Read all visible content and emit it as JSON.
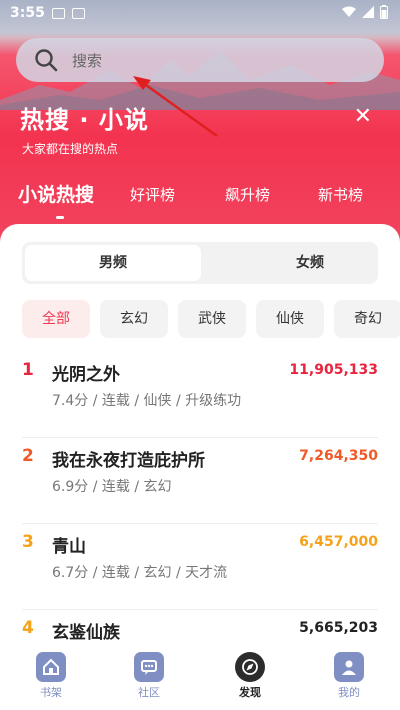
{
  "status_bar": {
    "time": "3:55"
  },
  "search": {
    "placeholder": "搜索"
  },
  "hero": {
    "title": "热搜 · 小说",
    "subtitle": "大家都在搜的热点"
  },
  "tabs": [
    {
      "label": "小说热搜"
    },
    {
      "label": "好评榜"
    },
    {
      "label": "飙升榜"
    },
    {
      "label": "新书榜"
    }
  ],
  "gender": {
    "male": "男频",
    "female": "女频"
  },
  "categories": [
    "全部",
    "玄幻",
    "武侠",
    "仙侠",
    "奇幻"
  ],
  "rankings": [
    {
      "rank": "1",
      "title": "光阴之外",
      "meta": "7.4分 / 连载 / 仙侠 / 升级练功",
      "count": "11,905,133"
    },
    {
      "rank": "2",
      "title": "我在永夜打造庇护所",
      "meta": "6.9分 / 连载 / 玄幻",
      "count": "7,264,350"
    },
    {
      "rank": "3",
      "title": "青山",
      "meta": "6.7分 / 连载 / 玄幻 / 天才流",
      "count": "6,457,000"
    },
    {
      "rank": "4",
      "title": "玄鉴仙族",
      "meta": "",
      "count": "5,665,203"
    }
  ],
  "colors": {
    "rank1": "#e8243f",
    "rank2": "#f05a28",
    "rank3": "#f5a21a",
    "rank4": "#f5a21a",
    "accent": "#ef3a52",
    "nav_icon": "#7f8fc3"
  },
  "bottom_nav": [
    {
      "label": "书架",
      "icon": "bookshelf-icon"
    },
    {
      "label": "社区",
      "icon": "community-icon"
    },
    {
      "label": "发现",
      "icon": "compass-icon"
    },
    {
      "label": "我的",
      "icon": "profile-icon"
    }
  ]
}
